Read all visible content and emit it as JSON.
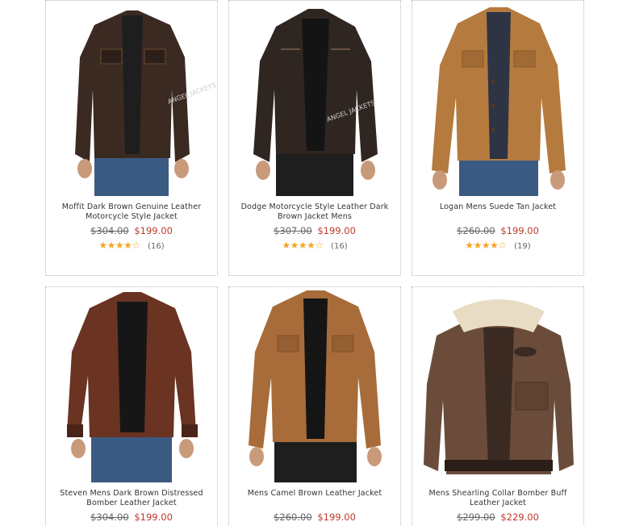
{
  "products": [
    {
      "name": "Moffit Dark Brown Genuine Leather Motorcycle Style Jacket",
      "old_price": "$304.00",
      "price": "$199.00",
      "stars_full": 4,
      "stars_empty": 1,
      "reviews": "(16)",
      "image": "jacket-image",
      "jacket_color": "#3b2a22",
      "watermark": "ANGEL JACKETS"
    },
    {
      "name": "Dodge Motorcycle Style Leather Dark Brown Jacket Mens",
      "old_price": "$307.00",
      "price": "$199.00",
      "stars_full": 4,
      "stars_empty": 1,
      "reviews": "(16)",
      "image": "jacket-image",
      "jacket_color": "#2f2622",
      "watermark": "ANGEL JACKETS"
    },
    {
      "name": "Logan Mens Suede Tan Jacket",
      "old_price": "$260.00",
      "price": "$199.00",
      "stars_full": 4,
      "stars_empty": 1,
      "reviews": "(19)",
      "image": "jacket-image",
      "jacket_color": "#b57a3e"
    },
    {
      "name": "Steven Mens Dark Brown Distressed Bomber Leather Jacket",
      "old_price": "$304.00",
      "price": "$199.00",
      "image": "jacket-image",
      "jacket_color": "#6a3322"
    },
    {
      "name": "Mens Camel Brown Leather Jacket",
      "old_price": "$260.00",
      "price": "$199.00",
      "image": "jacket-image",
      "jacket_color": "#a86c3a"
    },
    {
      "name": "Mens Shearling Collar Bomber Buff Leather Jacket",
      "old_price": "$299.00",
      "price": "$229.00",
      "image": "jacket-image",
      "jacket_color": "#6b4c3a"
    }
  ],
  "colors": {
    "price": "#c0392b",
    "star": "#f5a623",
    "border": "#b9b9b9"
  }
}
